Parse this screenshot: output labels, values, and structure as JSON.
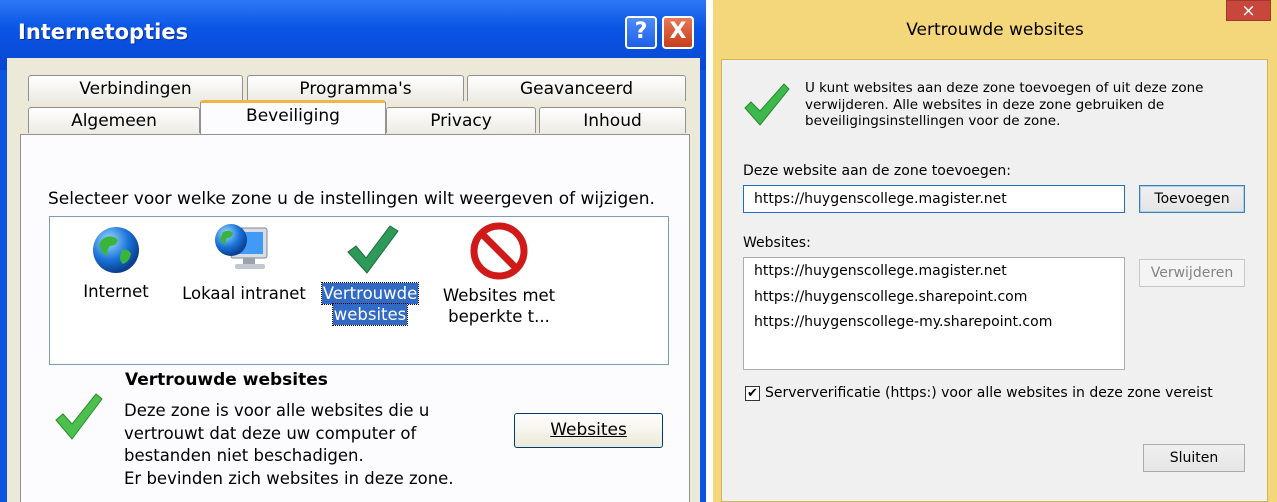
{
  "internet_options": {
    "title": "Internetopties",
    "tabs_row1": [
      "Verbindingen",
      "Programma's",
      "Geavanceerd"
    ],
    "tabs_row2": [
      "Algemeen",
      "Beveiliging",
      "Privacy",
      "Inhoud"
    ],
    "active_tab": "Beveiliging",
    "select_zone_text": "Selecteer voor welke zone u de instellingen wilt weergeven of wijzigen.",
    "zones": [
      {
        "icon": "globe-icon",
        "label_line1": "Internet",
        "label_line2": ""
      },
      {
        "icon": "intranet-computer-icon",
        "label_line1": "Lokaal intranet",
        "label_line2": ""
      },
      {
        "icon": "checkmark-icon",
        "label_line1": "Vertrouwde",
        "label_line2": "websites"
      },
      {
        "icon": "restricted-icon",
        "label_line1": "Websites met",
        "label_line2": "beperkte t..."
      }
    ],
    "selected_zone": "Vertrouwde websites",
    "info_title": "Vertrouwde websites",
    "info_lines": [
      "Deze zone is voor alle websites die u",
      "vertrouwt dat deze uw computer of",
      "bestanden niet beschadigen.",
      "Er bevinden zich websites in deze zone."
    ],
    "websites_button": "Websites",
    "help_button": "?",
    "close_button": "X"
  },
  "trusted_sites": {
    "title": "Vertrouwde websites",
    "close_button": "×",
    "intro_lines": [
      "U kunt websites aan deze zone toevoegen of uit deze zone",
      "verwijderen. Alle websites in deze zone gebruiken de",
      "beveiligingsinstellingen voor de zone."
    ],
    "add_label": "Deze website aan de zone toevoegen:",
    "add_input_value": "https://huygenscollege.magister.net",
    "add_button": "Toevoegen",
    "websites_label": "Websites:",
    "websites": [
      "https://huygenscollege.magister.net",
      "https://huygenscollege.sharepoint.com",
      "https://huygenscollege-my.sharepoint.com"
    ],
    "remove_button": "Verwijderen",
    "require_https_checked": true,
    "require_https_label": "Serververificatie (https:) voor alle websites in deze zone vereist",
    "close_dialog_button": "Sluiten"
  },
  "colors": {
    "xp_titlebar": "#0b55e5",
    "xp_selection": "#316ac5",
    "w8_frame": "#f5d77b",
    "w8_close": "#c7473c",
    "check_green": "#2bb24c"
  }
}
